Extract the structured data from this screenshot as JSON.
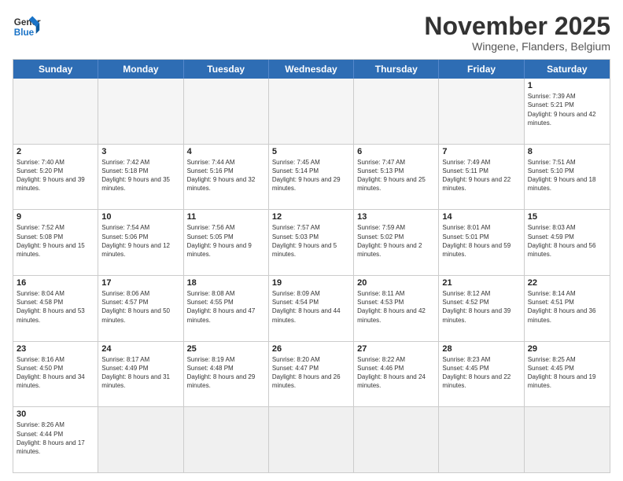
{
  "logo": {
    "text_general": "General",
    "text_blue": "Blue"
  },
  "header": {
    "month_title": "November 2025",
    "location": "Wingene, Flanders, Belgium"
  },
  "weekdays": [
    "Sunday",
    "Monday",
    "Tuesday",
    "Wednesday",
    "Thursday",
    "Friday",
    "Saturday"
  ],
  "weeks": [
    [
      {
        "day": "",
        "info": ""
      },
      {
        "day": "",
        "info": ""
      },
      {
        "day": "",
        "info": ""
      },
      {
        "day": "",
        "info": ""
      },
      {
        "day": "",
        "info": ""
      },
      {
        "day": "",
        "info": ""
      },
      {
        "day": "1",
        "info": "Sunrise: 7:39 AM\nSunset: 5:21 PM\nDaylight: 9 hours and 42 minutes."
      }
    ],
    [
      {
        "day": "2",
        "info": "Sunrise: 7:40 AM\nSunset: 5:20 PM\nDaylight: 9 hours and 39 minutes."
      },
      {
        "day": "3",
        "info": "Sunrise: 7:42 AM\nSunset: 5:18 PM\nDaylight: 9 hours and 35 minutes."
      },
      {
        "day": "4",
        "info": "Sunrise: 7:44 AM\nSunset: 5:16 PM\nDaylight: 9 hours and 32 minutes."
      },
      {
        "day": "5",
        "info": "Sunrise: 7:45 AM\nSunset: 5:14 PM\nDaylight: 9 hours and 29 minutes."
      },
      {
        "day": "6",
        "info": "Sunrise: 7:47 AM\nSunset: 5:13 PM\nDaylight: 9 hours and 25 minutes."
      },
      {
        "day": "7",
        "info": "Sunrise: 7:49 AM\nSunset: 5:11 PM\nDaylight: 9 hours and 22 minutes."
      },
      {
        "day": "8",
        "info": "Sunrise: 7:51 AM\nSunset: 5:10 PM\nDaylight: 9 hours and 18 minutes."
      }
    ],
    [
      {
        "day": "9",
        "info": "Sunrise: 7:52 AM\nSunset: 5:08 PM\nDaylight: 9 hours and 15 minutes."
      },
      {
        "day": "10",
        "info": "Sunrise: 7:54 AM\nSunset: 5:06 PM\nDaylight: 9 hours and 12 minutes."
      },
      {
        "day": "11",
        "info": "Sunrise: 7:56 AM\nSunset: 5:05 PM\nDaylight: 9 hours and 9 minutes."
      },
      {
        "day": "12",
        "info": "Sunrise: 7:57 AM\nSunset: 5:03 PM\nDaylight: 9 hours and 5 minutes."
      },
      {
        "day": "13",
        "info": "Sunrise: 7:59 AM\nSunset: 5:02 PM\nDaylight: 9 hours and 2 minutes."
      },
      {
        "day": "14",
        "info": "Sunrise: 8:01 AM\nSunset: 5:01 PM\nDaylight: 8 hours and 59 minutes."
      },
      {
        "day": "15",
        "info": "Sunrise: 8:03 AM\nSunset: 4:59 PM\nDaylight: 8 hours and 56 minutes."
      }
    ],
    [
      {
        "day": "16",
        "info": "Sunrise: 8:04 AM\nSunset: 4:58 PM\nDaylight: 8 hours and 53 minutes."
      },
      {
        "day": "17",
        "info": "Sunrise: 8:06 AM\nSunset: 4:57 PM\nDaylight: 8 hours and 50 minutes."
      },
      {
        "day": "18",
        "info": "Sunrise: 8:08 AM\nSunset: 4:55 PM\nDaylight: 8 hours and 47 minutes."
      },
      {
        "day": "19",
        "info": "Sunrise: 8:09 AM\nSunset: 4:54 PM\nDaylight: 8 hours and 44 minutes."
      },
      {
        "day": "20",
        "info": "Sunrise: 8:11 AM\nSunset: 4:53 PM\nDaylight: 8 hours and 42 minutes."
      },
      {
        "day": "21",
        "info": "Sunrise: 8:12 AM\nSunset: 4:52 PM\nDaylight: 8 hours and 39 minutes."
      },
      {
        "day": "22",
        "info": "Sunrise: 8:14 AM\nSunset: 4:51 PM\nDaylight: 8 hours and 36 minutes."
      }
    ],
    [
      {
        "day": "23",
        "info": "Sunrise: 8:16 AM\nSunset: 4:50 PM\nDaylight: 8 hours and 34 minutes."
      },
      {
        "day": "24",
        "info": "Sunrise: 8:17 AM\nSunset: 4:49 PM\nDaylight: 8 hours and 31 minutes."
      },
      {
        "day": "25",
        "info": "Sunrise: 8:19 AM\nSunset: 4:48 PM\nDaylight: 8 hours and 29 minutes."
      },
      {
        "day": "26",
        "info": "Sunrise: 8:20 AM\nSunset: 4:47 PM\nDaylight: 8 hours and 26 minutes."
      },
      {
        "day": "27",
        "info": "Sunrise: 8:22 AM\nSunset: 4:46 PM\nDaylight: 8 hours and 24 minutes."
      },
      {
        "day": "28",
        "info": "Sunrise: 8:23 AM\nSunset: 4:45 PM\nDaylight: 8 hours and 22 minutes."
      },
      {
        "day": "29",
        "info": "Sunrise: 8:25 AM\nSunset: 4:45 PM\nDaylight: 8 hours and 19 minutes."
      }
    ],
    [
      {
        "day": "30",
        "info": "Sunrise: 8:26 AM\nSunset: 4:44 PM\nDaylight: 8 hours and 17 minutes."
      },
      {
        "day": "",
        "info": ""
      },
      {
        "day": "",
        "info": ""
      },
      {
        "day": "",
        "info": ""
      },
      {
        "day": "",
        "info": ""
      },
      {
        "day": "",
        "info": ""
      },
      {
        "day": "",
        "info": ""
      }
    ]
  ]
}
